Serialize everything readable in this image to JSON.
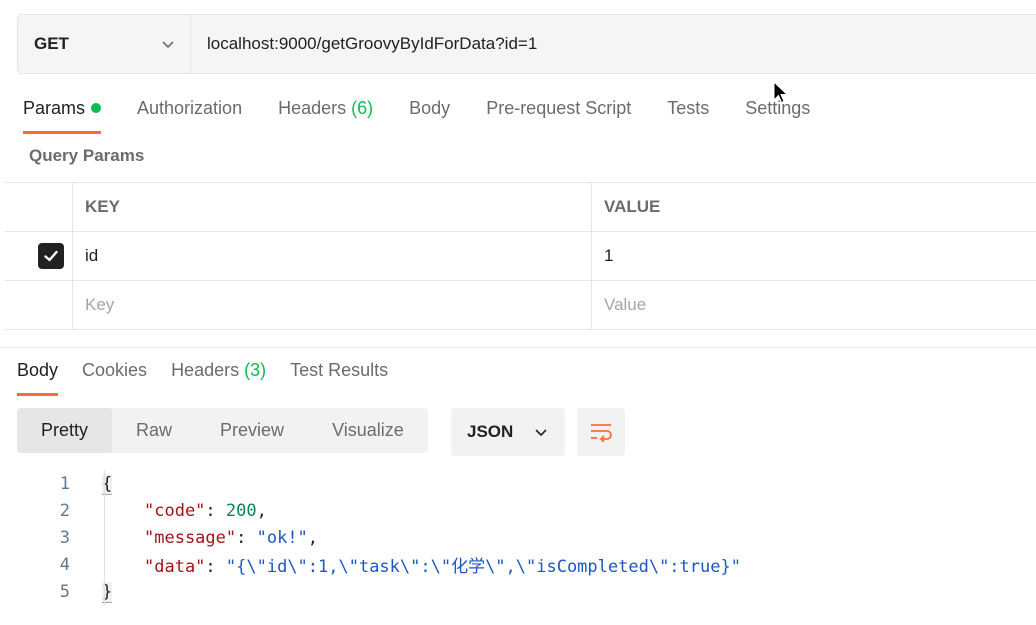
{
  "request": {
    "method": "GET",
    "url": "localhost:9000/getGroovyByIdForData?id=1"
  },
  "request_tabs": [
    {
      "label": "Params",
      "active": true,
      "dot": true
    },
    {
      "label": "Authorization"
    },
    {
      "label": "Headers",
      "count": "(6)"
    },
    {
      "label": "Body"
    },
    {
      "label": "Pre-request Script"
    },
    {
      "label": "Tests"
    },
    {
      "label": "Settings"
    }
  ],
  "query_params": {
    "title": "Query Params",
    "headers": {
      "key": "KEY",
      "value": "VALUE"
    },
    "rows": [
      {
        "key": "id",
        "value": "1",
        "checked": true
      }
    ],
    "placeholder": {
      "key": "Key",
      "value": "Value"
    }
  },
  "response_tabs": [
    {
      "label": "Body",
      "active": true
    },
    {
      "label": "Cookies"
    },
    {
      "label": "Headers",
      "count": "(3)"
    },
    {
      "label": "Test Results"
    }
  ],
  "format": {
    "modes": [
      "Pretty",
      "Raw",
      "Preview",
      "Visualize"
    ],
    "active": "Pretty",
    "language": "JSON"
  },
  "code": {
    "line_numbers": [
      "1",
      "2",
      "3",
      "4",
      "5"
    ],
    "open_brace": "{",
    "close_brace": "}",
    "fields": [
      {
        "key": "\"code\"",
        "value": "200",
        "type": "num",
        "trail": ","
      },
      {
        "key": "\"message\"",
        "value": "\"ok!\"",
        "type": "str",
        "trail": ","
      },
      {
        "key": "\"data\"",
        "value": "\"{\\\"id\\\":1,\\\"task\\\":\\\"化学\\\",\\\"isCompleted\\\":true}\"",
        "type": "str",
        "trail": ""
      }
    ]
  },
  "colors": {
    "accent": "#ff6c37",
    "success": "#0cbb52"
  }
}
